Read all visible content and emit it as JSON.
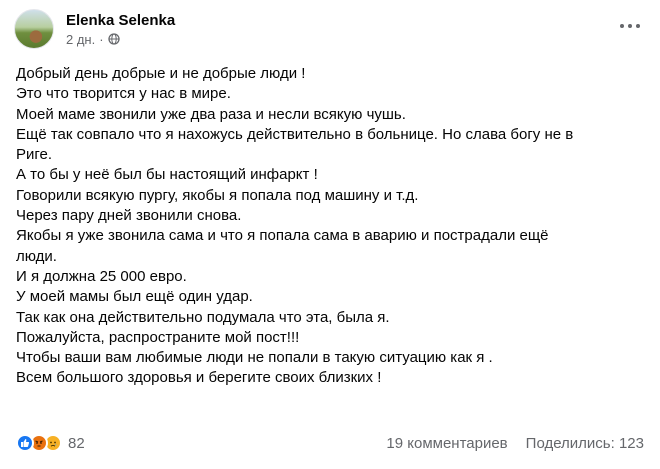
{
  "post": {
    "author": "Elenka Selenka",
    "time": "2 дн.",
    "separator": "·",
    "icons": {
      "avatar": "profile-photo",
      "audience": "globe-icon",
      "more": "more-options-icon"
    },
    "body_lines": [
      "Добрый день добрые и не добрые люди !",
      "Это что творится у нас в мире.",
      "Моей маме звонили уже два раза и несли всякую чушь.",
      "Ещё так совпало что я нахожусь действительно в больнице. Но слава богу не в",
      "Риге.",
      "А то бы у неё был бы настоящий инфаркт !",
      "Говорили всякую пургу, якобы я попала под машину и т.д.",
      "Через пару дней звонили снова.",
      "Якобы я уже звонила сама и что я попала  сама в аварию и пострадали ещё",
      "люди.",
      "И я должна 25 000 евро.",
      "У моей мамы был ещё один удар.",
      "Так как она действительно подумала что эта, была я.",
      "Пожалуйста, распространите мой пост!!!",
      "Чтобы ваши вам любимые люди не попали в такую ситуацию как я .",
      "Всем большого здоровья  и берегите своих близких !"
    ],
    "reactions": {
      "count": "82",
      "types": [
        "like",
        "angry",
        "sad"
      ]
    },
    "comments": "19 комментариев",
    "shares": "Поделились: 123",
    "colors": {
      "text": "#050505",
      "secondary": "#65676b",
      "like": "#1877f2",
      "angry": "#e9710f",
      "sad": "#f7b125"
    }
  }
}
